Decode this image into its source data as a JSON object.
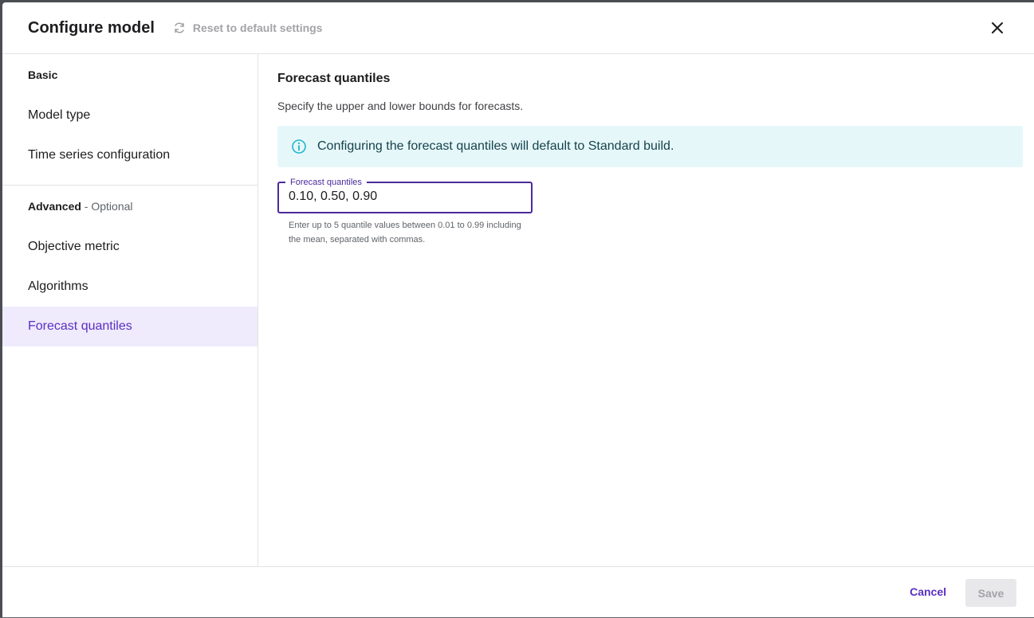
{
  "header": {
    "title": "Configure model",
    "reset_label": "Reset to default settings",
    "icons": {
      "reset": "refresh-icon",
      "close": "close-icon"
    }
  },
  "sidebar": {
    "basic_heading": "Basic",
    "basic_items": [
      {
        "label": "Model type"
      },
      {
        "label": "Time series configuration"
      }
    ],
    "advanced_heading": "Advanced",
    "advanced_optional": " - Optional",
    "advanced_items": [
      {
        "label": "Objective metric"
      },
      {
        "label": "Algorithms"
      },
      {
        "label": "Forecast quantiles",
        "active": true
      }
    ]
  },
  "main": {
    "title": "Forecast quantiles",
    "description": "Specify the upper and lower bounds for forecasts.",
    "alert": {
      "icon": "info-icon",
      "text": "Configuring the forecast quantiles will default to Standard build."
    },
    "field": {
      "label": "Forecast quantiles",
      "value": "0.10, 0.50, 0.90",
      "helper": "Enter up to 5 quantile values between 0.01 to 0.99 including the mean, separated with commas."
    }
  },
  "footer": {
    "cancel_label": "Cancel",
    "save_label": "Save"
  },
  "colors": {
    "accent": "#5a2fc2",
    "active_bg": "#efeafc",
    "alert_bg": "#e6f7fa",
    "info_icon": "#1fb8c9"
  }
}
